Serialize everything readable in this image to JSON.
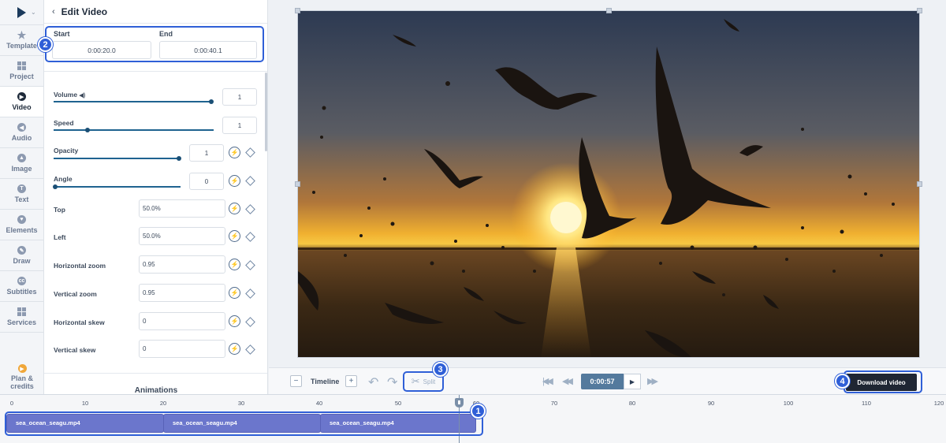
{
  "rail": {
    "items": [
      {
        "label": "Template",
        "icon": "star-icon"
      },
      {
        "label": "Project",
        "icon": "grid-icon"
      },
      {
        "label": "Video",
        "icon": "play-circle-icon"
      },
      {
        "label": "Audio",
        "icon": "audio-icon"
      },
      {
        "label": "Image",
        "icon": "image-icon"
      },
      {
        "label": "Text",
        "icon": "text-icon"
      },
      {
        "label": "Elements",
        "icon": "elements-icon"
      },
      {
        "label": "Draw",
        "icon": "draw-icon"
      },
      {
        "label": "Subtitles",
        "icon": "cc-icon"
      },
      {
        "label": "Services",
        "icon": "services-icon"
      }
    ],
    "plan_line1": "Plan &",
    "plan_line2": "credits"
  },
  "panel": {
    "title": "Edit Video",
    "start_label": "Start",
    "start_value": "0:00:20.0",
    "end_label": "End",
    "end_value": "0:00:40.1",
    "volume": {
      "label": "Volume",
      "value": "1",
      "level": 1.0
    },
    "speed": {
      "label": "Speed",
      "value": "1",
      "level": 0.25
    },
    "opacity": {
      "label": "Opacity",
      "value": "1",
      "level": 1.0
    },
    "angle": {
      "label": "Angle",
      "value": "0",
      "level": 0.0
    },
    "top": {
      "label": "Top",
      "value": "50.0%"
    },
    "left": {
      "label": "Left",
      "value": "50.0%"
    },
    "hzoom": {
      "label": "Horizontal zoom",
      "value": "0.95"
    },
    "vzoom": {
      "label": "Vertical zoom",
      "value": "0.95"
    },
    "hskew": {
      "label": "Horizontal skew",
      "value": "0"
    },
    "vskew": {
      "label": "Vertical skew",
      "value": "0"
    },
    "animations_label": "Animations"
  },
  "controls": {
    "timeline_label": "Timeline",
    "zoom_out": "−",
    "zoom_in": "+",
    "split_label": "Split",
    "timecode": "0:00:57",
    "download_label": "Download video"
  },
  "timeline": {
    "ticks": [
      "0",
      "10",
      "20",
      "30",
      "40",
      "50",
      "60",
      "70",
      "80",
      "90",
      "100",
      "110",
      "120"
    ],
    "clips": [
      {
        "label": "sea_ocean_seagu.mp4"
      },
      {
        "label": "sea_ocean_seagu.mp4"
      },
      {
        "label": "sea_ocean_seagu.mp4"
      }
    ],
    "playhead_seconds": 57
  },
  "callouts": [
    "1",
    "2",
    "3",
    "4"
  ],
  "colors": {
    "accent": "#2f5fd7",
    "clip": "#6b76cc",
    "download": "#1f2633",
    "timecode_bg": "#547a9d"
  }
}
